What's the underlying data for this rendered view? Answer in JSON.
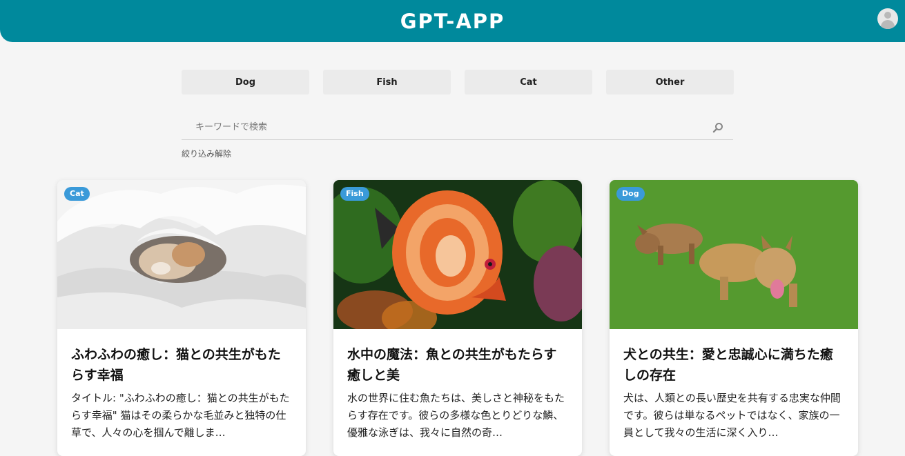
{
  "header": {
    "title": "GPT-APP"
  },
  "filters": [
    {
      "label": "Dog"
    },
    {
      "label": "Fish"
    },
    {
      "label": "Cat"
    },
    {
      "label": "Other"
    }
  ],
  "search": {
    "placeholder": "キーワードで検索",
    "value": ""
  },
  "clear_filter_label": "絞り込み解除",
  "colors": {
    "header": "#00899c",
    "badge": "#3a9ad9",
    "background": "#f5f5f5"
  },
  "cards": [
    {
      "badge": "Cat",
      "image_subject": "cat-under-blanket",
      "title": "ふわふわの癒し：猫との共生がもたらす幸福",
      "text": "タイトル: \"ふわふわの癒し：猫との共生がもたらす幸福\" 猫はその柔らかな毛並みと独特の仕草で、人々の心を掴んで離しま…"
    },
    {
      "badge": "Fish",
      "image_subject": "discus-fish",
      "title": "水中の魔法：魚との共生がもたらす癒しと美",
      "text": "水の世界に住む魚たちは、美しさと神秘をもたらす存在です。彼らの多様な色とりどりな鱗、優雅な泳ぎは、我々に自然の奇…"
    },
    {
      "badge": "Dog",
      "image_subject": "terriers-on-grass",
      "title": "犬との共生：愛と忠誠心に満ちた癒しの存在",
      "text": "犬は、人類との長い歴史を共有する忠実な仲間です。彼らは単なるペットではなく、家族の一員として我々の生活に深く入り…"
    }
  ]
}
